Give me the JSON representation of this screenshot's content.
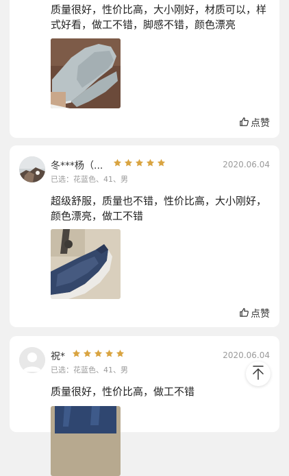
{
  "reviews": [
    {
      "text": "质量很好，性价比高，大小刚好，材质可以，样式好看，做工不错，脚感不错，颜色漂亮",
      "photo_icon": "grey-knit-sneaker-photo",
      "like_label": "点赞"
    },
    {
      "username": "冬***杨（...",
      "rating": 5,
      "date": "2020.06.04",
      "spec": "已选：花蓝色、41、男",
      "text": "超级舒服，质量也不错，性价比高，大小刚好，颜色漂亮，做工不错",
      "photo_icon": "blue-knit-sneaker-photo",
      "like_label": "点赞"
    },
    {
      "username": "祝*",
      "rating": 5,
      "date": "2020.06.04",
      "spec": "已选：花蓝色、41、男",
      "text": "质量很好，性价比高，做工不错",
      "photo_icon": "blue-knit-sneaker-photo"
    }
  ],
  "colors": {
    "star": "#d9a441",
    "muted_text": "#9a9a9a",
    "card_bg": "#ffffff",
    "page_bg": "#f1f1f1"
  },
  "icons": {
    "like": "thumbs-up-icon",
    "back_to_top": "arrow-up-icon"
  }
}
